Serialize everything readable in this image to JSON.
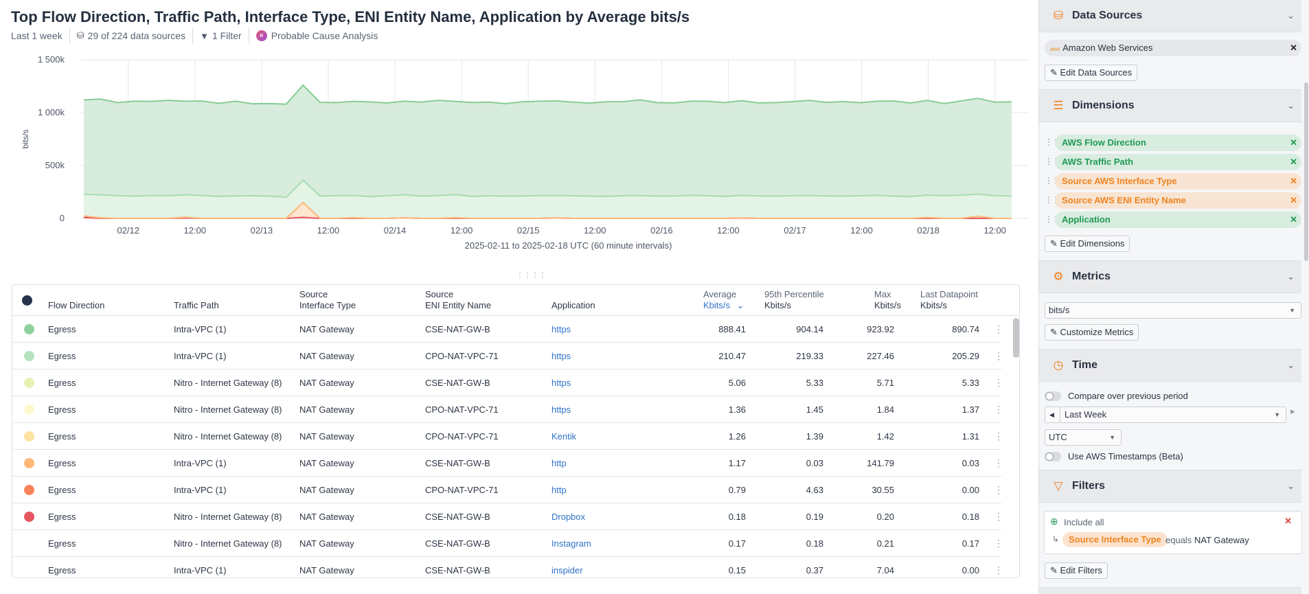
{
  "header": {
    "title": "Top Flow Direction, Traffic Path, Interface Type, ENI Entity Name, Application by Average bits/s",
    "time_range": "Last 1 week",
    "data_sources": "29 of 224 data sources",
    "filters": "1 Filter",
    "pca": "Probable Cause Analysis"
  },
  "chart_data": {
    "type": "area",
    "stacked": true,
    "ylabel": "bits/s",
    "xlabel": "2025-02-11 to 2025-02-18 UTC (60 minute intervals)",
    "x_start": "2025-02-11 16:00",
    "x_end": "2025-02-18 15:00",
    "x_step_hours": 3,
    "ylim": [
      0,
      1500000
    ],
    "yticks": [
      "0",
      "500k",
      "1 000k",
      "1 500k"
    ],
    "xticks": [
      "02/12",
      "12:00",
      "02/13",
      "12:00",
      "02/14",
      "12:00",
      "02/15",
      "12:00",
      "02/16",
      "12:00",
      "02/17",
      "12:00",
      "02/18",
      "12:00"
    ],
    "grid": true,
    "series": [
      {
        "color": "#e5555e",
        "values": [
          8,
          0,
          0,
          0,
          0,
          0,
          3,
          0,
          0,
          0,
          0,
          0,
          0,
          10,
          0,
          0,
          0,
          0,
          0,
          5,
          0,
          0,
          0,
          0,
          0,
          0,
          0,
          0,
          4,
          0,
          0,
          0,
          0,
          0,
          0,
          0,
          0,
          0,
          0,
          3,
          0,
          0,
          0,
          0,
          0,
          0,
          0,
          0,
          0,
          0,
          0,
          0,
          0,
          0,
          0,
          0
        ]
      },
      {
        "color": "#fdb877",
        "values": [
          15,
          5,
          0,
          0,
          0,
          0,
          8,
          0,
          0,
          0,
          0,
          0,
          0,
          140,
          0,
          0,
          6,
          0,
          0,
          0,
          0,
          0,
          6,
          0,
          0,
          0,
          0,
          0,
          0,
          0,
          0,
          0,
          0,
          0,
          0,
          0,
          0,
          0,
          0,
          0,
          0,
          0,
          0,
          0,
          0,
          0,
          0,
          0,
          0,
          0,
          8,
          0,
          0,
          20,
          0,
          0
        ]
      },
      {
        "color": "#a8dcb0",
        "fill": "#e3f3e5",
        "values": [
          205,
          218,
          215,
          210,
          216,
          214,
          212,
          217,
          208,
          213,
          214,
          210,
          200,
          210,
          212,
          215,
          210,
          206,
          214,
          218,
          210,
          216,
          220,
          208,
          214,
          210,
          212,
          216,
          212,
          214,
          210,
          208,
          214,
          216,
          210,
          212,
          218,
          214,
          208,
          215,
          212,
          210,
          214,
          216,
          212,
          210,
          214,
          218,
          210,
          206,
          212,
          215,
          220,
          210,
          214,
          212
        ]
      },
      {
        "color": "#86cc95",
        "fill": "#d8ecdd",
        "values": [
          892,
          905,
          880,
          898,
          890,
          902,
          885,
          893,
          880,
          895,
          870,
          875,
          880,
          900,
          885,
          880,
          890,
          895,
          878,
          885,
          890,
          900,
          880,
          888,
          885,
          875,
          890,
          892,
          895,
          885,
          880,
          895,
          890,
          905,
          885,
          880,
          890,
          893,
          887,
          895,
          880,
          885,
          890,
          900,
          885,
          895,
          880,
          890,
          900,
          885,
          895,
          870,
          890,
          905,
          885,
          890
        ]
      }
    ]
  },
  "table": {
    "headers": {
      "color": "",
      "flow": "Flow Direction",
      "path": "Traffic Path",
      "sit1": "Source",
      "sit2": "Interface Type",
      "eni1": "Source",
      "eni2": "ENI Entity Name",
      "app": "Application",
      "avg1": "Average",
      "avg2": "Kbits/s",
      "p951": "95th Percentile",
      "p952": "Kbits/s",
      "max1": "Max",
      "max2": "Kbits/s",
      "last1": "Last Datapoint",
      "last2": "Kbits/s"
    },
    "header_dot_color": "#25334a",
    "rows": [
      {
        "color": "#8fd19e",
        "flow": "Egress",
        "path": "Intra-VPC (1)",
        "sit": "NAT Gateway",
        "eni": "CSE-NAT-GW-B",
        "app": "https",
        "avg": "888.41",
        "p95": "904.14",
        "max": "923.92",
        "last": "890.74"
      },
      {
        "color": "#b6e3bf",
        "flow": "Egress",
        "path": "Intra-VPC (1)",
        "sit": "NAT Gateway",
        "eni": "CPO-NAT-VPC-71",
        "app": "https",
        "avg": "210.47",
        "p95": "219.33",
        "max": "227.46",
        "last": "205.29"
      },
      {
        "color": "#e6f1b4",
        "flow": "Egress",
        "path": "Nitro - Internet Gateway (8)",
        "sit": "NAT Gateway",
        "eni": "CSE-NAT-GW-B",
        "app": "https",
        "avg": "5.06",
        "p95": "5.33",
        "max": "5.71",
        "last": "5.33"
      },
      {
        "color": "#fcf9cf",
        "flow": "Egress",
        "path": "Nitro - Internet Gateway (8)",
        "sit": "NAT Gateway",
        "eni": "CPO-NAT-VPC-71",
        "app": "https",
        "avg": "1.36",
        "p95": "1.45",
        "max": "1.84",
        "last": "1.37"
      },
      {
        "color": "#fde2a2",
        "flow": "Egress",
        "path": "Nitro - Internet Gateway (8)",
        "sit": "NAT Gateway",
        "eni": "CPO-NAT-VPC-71",
        "app": "Kentik",
        "avg": "1.26",
        "p95": "1.39",
        "max": "1.42",
        "last": "1.31"
      },
      {
        "color": "#fdb877",
        "flow": "Egress",
        "path": "Intra-VPC (1)",
        "sit": "NAT Gateway",
        "eni": "CSE-NAT-GW-B",
        "app": "http",
        "avg": "1.17",
        "p95": "0.03",
        "max": "141.79",
        "last": "0.03"
      },
      {
        "color": "#f9825a",
        "flow": "Egress",
        "path": "Intra-VPC (1)",
        "sit": "NAT Gateway",
        "eni": "CPO-NAT-VPC-71",
        "app": "http",
        "avg": "0.79",
        "p95": "4.63",
        "max": "30.55",
        "last": "0.00"
      },
      {
        "color": "#e5555e",
        "flow": "Egress",
        "path": "Nitro - Internet Gateway (8)",
        "sit": "NAT Gateway",
        "eni": "CSE-NAT-GW-B",
        "app": "Dropbox",
        "avg": "0.18",
        "p95": "0.19",
        "max": "0.20",
        "last": "0.18"
      },
      {
        "color": "",
        "flow": "Egress",
        "path": "Nitro - Internet Gateway (8)",
        "sit": "NAT Gateway",
        "eni": "CSE-NAT-GW-B",
        "app": "Instagram",
        "avg": "0.17",
        "p95": "0.18",
        "max": "0.21",
        "last": "0.17"
      },
      {
        "color": "",
        "flow": "Egress",
        "path": "Intra-VPC (1)",
        "sit": "NAT Gateway",
        "eni": "CSE-NAT-GW-B",
        "app": "inspider",
        "avg": "0.15",
        "p95": "0.37",
        "max": "7.04",
        "last": "0.00"
      }
    ]
  },
  "sidebar": {
    "data_sources": {
      "title": "Data Sources",
      "chip": "Amazon Web Services",
      "aws": "aws",
      "edit": "Edit Data Sources"
    },
    "dimensions": {
      "title": "Dimensions",
      "items": [
        {
          "label": "AWS Flow Direction",
          "kind": "g"
        },
        {
          "label": "AWS Traffic Path",
          "kind": "g"
        },
        {
          "label": "Source AWS Interface Type",
          "kind": "o"
        },
        {
          "label": "Source AWS ENI Entity Name",
          "kind": "o"
        },
        {
          "label": "Application",
          "kind": "g"
        }
      ],
      "edit": "Edit Dimensions"
    },
    "metrics": {
      "title": "Metrics",
      "selected": "bits/s",
      "edit": "Customize Metrics"
    },
    "time": {
      "title": "Time",
      "compare": "Compare over previous period",
      "range": "Last Week",
      "timezone": "UTC",
      "aws_ts": "Use AWS Timestamps (Beta)"
    },
    "filters": {
      "title": "Filters",
      "include": "Include all",
      "field": "Source Interface Type",
      "op": "equals",
      "value": "NAT Gateway",
      "edit": "Edit Filters"
    },
    "accent": "#f07d1a"
  }
}
